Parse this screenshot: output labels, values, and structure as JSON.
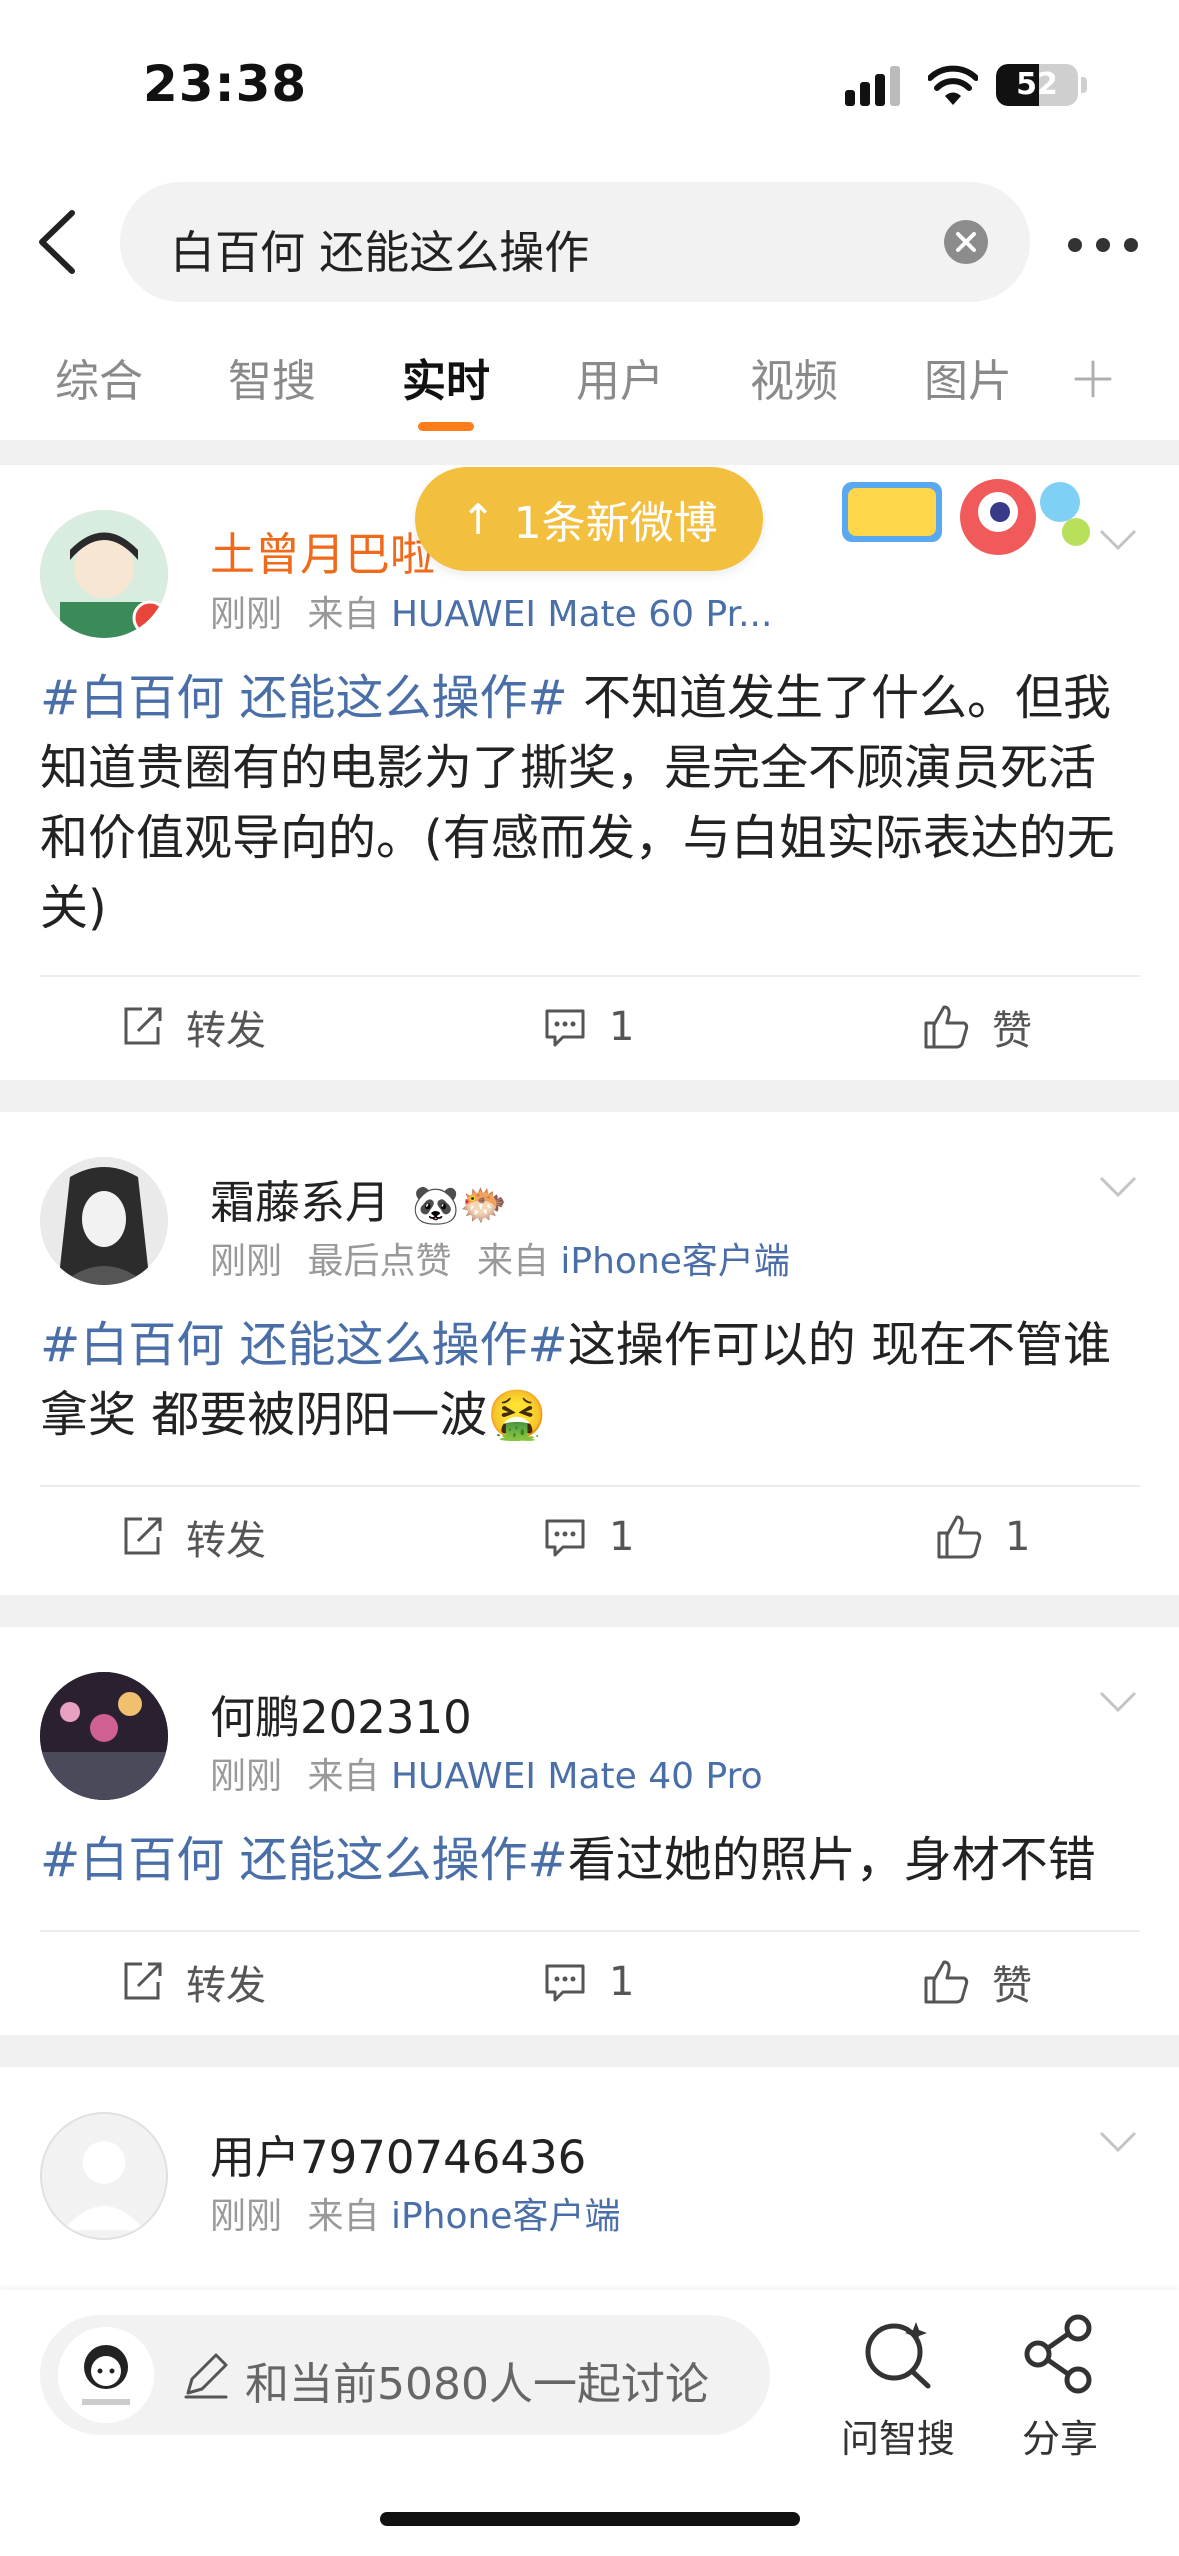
{
  "status_bar": {
    "time": "23:38",
    "battery": "52",
    "battery_level": 0.52
  },
  "search": {
    "query": "白百何 还能这么操作"
  },
  "tabs": [
    {
      "label": "综合",
      "active": false
    },
    {
      "label": "智搜",
      "active": false
    },
    {
      "label": "实时",
      "active": true
    },
    {
      "label": "用户",
      "active": false
    },
    {
      "label": "视频",
      "active": false
    },
    {
      "label": "图片",
      "active": false
    }
  ],
  "toast": {
    "label": "1条新微博"
  },
  "posts": [
    {
      "username": "土曾月巴啦",
      "time": "刚刚",
      "extra": "",
      "from_prefix": "来自",
      "source": "HUAWEI Mate 60 Pr...",
      "hashtag": "#白百何 还能这么操作#",
      "text": " 不知道发生了什么。但我知道贵圈有的电影为了撕奖，是完全不顾演员死活和价值观导向的。(有感而发，与白姐实际表达的无关)",
      "repost_label": "转发",
      "comment_count": "1",
      "like_label": "赞"
    },
    {
      "username": "霜藤系月",
      "username_emoji": "🐼🐡",
      "time": "刚刚",
      "extra": "最后点赞",
      "from_prefix": "来自",
      "source": "iPhone客户端",
      "hashtag": "#白百何 还能这么操作#",
      "text": "这操作可以的 现在不管谁拿奖 都要被阴阳一波🤮",
      "repost_label": "转发",
      "comment_count": "1",
      "like_label": "1"
    },
    {
      "username": "何鹏202310",
      "time": "刚刚",
      "extra": "",
      "from_prefix": "来自",
      "source": "HUAWEI Mate 40 Pro",
      "hashtag": "#白百何 还能这么操作#",
      "text": "看过她的照片，身材不错",
      "repost_label": "转发",
      "comment_count": "1",
      "like_label": "赞"
    },
    {
      "username": "用户7970746436",
      "time": "刚刚",
      "extra": "",
      "from_prefix": "来自",
      "source": "iPhone客户端"
    }
  ],
  "bottom": {
    "discuss_placeholder": "和当前5080人一起讨论",
    "ask_label": "问智搜",
    "share_label": "分享"
  },
  "colors": {
    "accent": "#ff7d1a",
    "link": "#4a6fa8",
    "toast": "#f3bf3e",
    "vip_name": "#f06a1c"
  }
}
